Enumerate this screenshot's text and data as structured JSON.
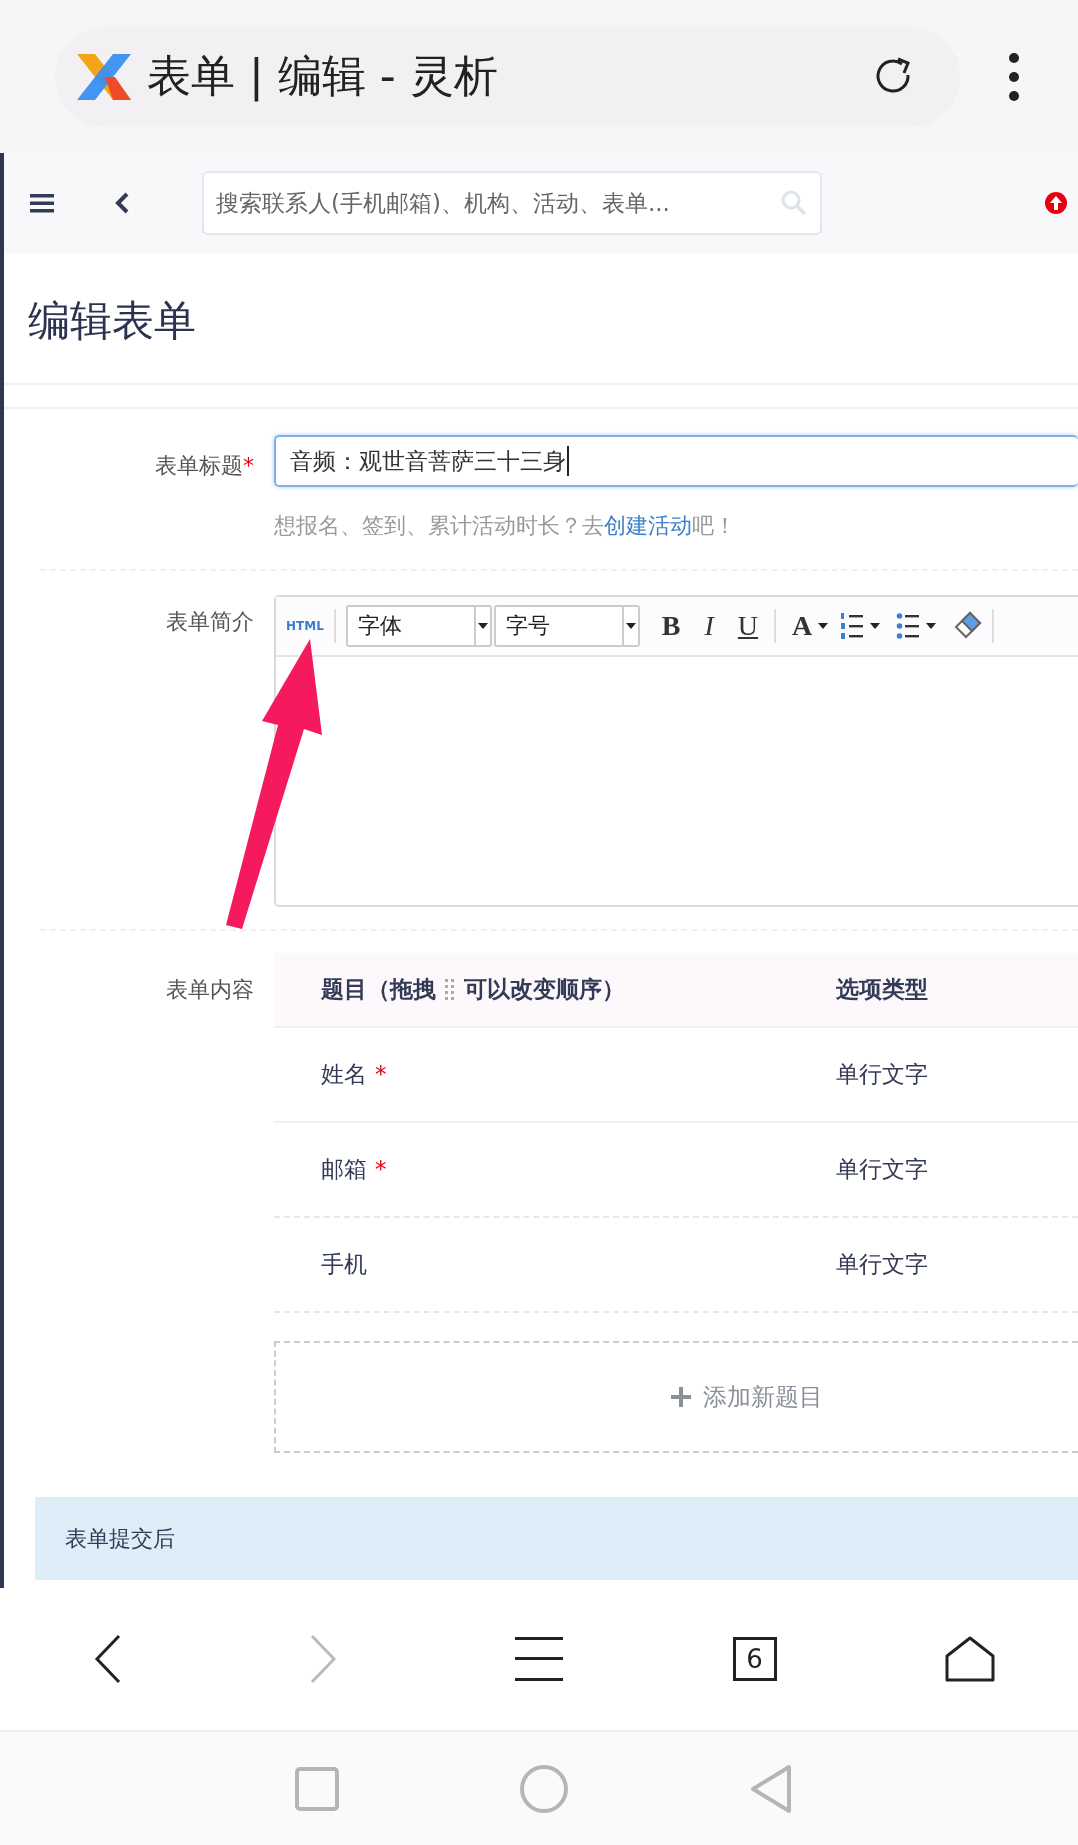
{
  "browser": {
    "title": "表单 | 编辑 - 灵析"
  },
  "app_bar": {
    "search": {
      "placeholder": "搜索联系人(手机邮箱)、机构、活动、表单..."
    }
  },
  "page_title": "编辑表单",
  "title_field": {
    "label": "表单标题",
    "required_mark": "*",
    "value": "音频：观世音菩萨三十三身",
    "focused": true
  },
  "hint": {
    "before": "想报名、签到、累计活动时长？去",
    "link": "创建活动",
    "after": "吧！"
  },
  "description": {
    "label": "表单简介",
    "tool_groups": [
      [
        {
          "kind": "html",
          "label": "HTML"
        }
      ],
      [
        {
          "kind": "select",
          "value": "字体"
        },
        {
          "kind": "select",
          "value": "字号"
        },
        {
          "kind": "bold",
          "label": "B"
        },
        {
          "kind": "italic",
          "label": "I"
        },
        {
          "kind": "underline",
          "label": "U"
        }
      ],
      [
        {
          "kind": "color",
          "label": "A"
        },
        {
          "kind": "ordered_list"
        },
        {
          "kind": "bullet_list"
        },
        {
          "kind": "eraser"
        }
      ]
    ]
  },
  "content": {
    "label": "表单内容",
    "header": {
      "before": "题目（拖拽",
      "after": "可以改变顺序）",
      "column_2": "选项类型"
    },
    "rows": [
      {
        "question": "姓名",
        "required_mark": "*",
        "type": "单行文字"
      },
      {
        "question": "邮箱",
        "required_mark": "*",
        "type": "单行文字"
      },
      {
        "question": "手机",
        "type": "单行文字"
      }
    ],
    "add_button": "添加新题目"
  },
  "section_bar": "表单提交后",
  "nav_buttons": [
    {
      "kind": "back",
      "disabled": false
    },
    {
      "kind": "forward",
      "disabled": true
    },
    {
      "kind": "menu",
      "disabled": false
    },
    {
      "kind": "tabs",
      "label": "6",
      "disabled": false
    },
    {
      "kind": "home",
      "disabled": false
    }
  ]
}
